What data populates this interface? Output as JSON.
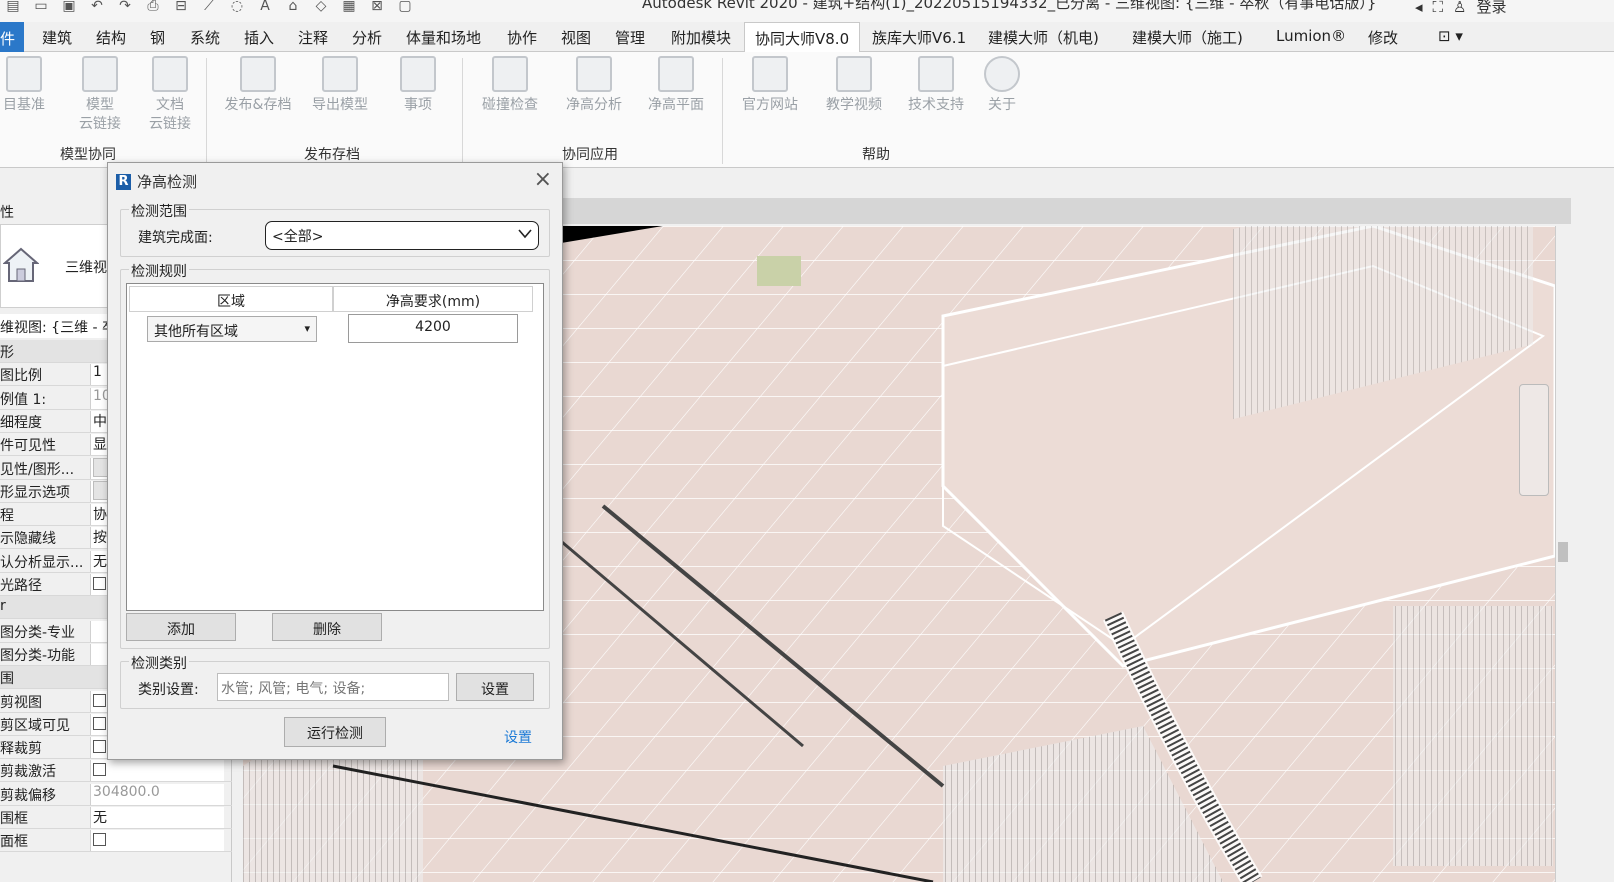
{
  "app": {
    "title": "Autodesk Revit 2020 - 建筑+结构(1)_20220515194332_已分离 - 三维视图: {三维 - 卒秋（有事电话版）}",
    "login": "登录"
  },
  "tabs": [
    "件",
    "建筑",
    "结构",
    "钢",
    "系统",
    "插入",
    "注释",
    "分析",
    "体量和场地",
    "协作",
    "视图",
    "管理",
    "附加模块",
    "协同大师V8.0",
    "族库大师V6.1",
    "建模大师（机电)",
    "建模大师（施工)",
    "Lumion®",
    "修改"
  ],
  "active_tab": "协同大师V8.0",
  "ribbon": {
    "buttons": [
      {
        "label": "目基准",
        "icon": "project-base-icon"
      },
      {
        "label": "模型\n云链接",
        "icon": "rvt-cloud-link-icon"
      },
      {
        "label": "文档\n云链接",
        "icon": "doc-cloud-link-icon"
      },
      {
        "label": "发布&存档",
        "icon": "publish-archive-icon"
      },
      {
        "label": "导出模型",
        "icon": "export-rvt-icon"
      },
      {
        "label": "事项",
        "icon": "checklist-icon"
      },
      {
        "label": "碰撞检查",
        "icon": "collision-check-icon"
      },
      {
        "label": "净高分析",
        "icon": "clearance-analysis-icon"
      },
      {
        "label": "净高平面",
        "icon": "clearance-plan-icon"
      },
      {
        "label": "官方网站",
        "icon": "website-icon"
      },
      {
        "label": "教学视频",
        "icon": "video-icon"
      },
      {
        "label": "技术支持",
        "icon": "support-icon"
      },
      {
        "label": "关于",
        "icon": "info-icon"
      }
    ],
    "groups": [
      "模型协同",
      "发布存档",
      "协同应用",
      "帮助"
    ]
  },
  "properties": {
    "header": "性",
    "type_name": "三维视",
    "view_selector": "维视图: {三维 - 卒",
    "rows": [
      {
        "k": "形",
        "v": "",
        "kind": "section"
      },
      {
        "k": "图比例",
        "v": "1",
        "kind": "text"
      },
      {
        "k": "例值 1:",
        "v": "10",
        "kind": "grey"
      },
      {
        "k": "细程度",
        "v": "中",
        "kind": "text"
      },
      {
        "k": "件可见性",
        "v": "显",
        "kind": "text"
      },
      {
        "k": "见性/图形...",
        "v": "",
        "kind": "button"
      },
      {
        "k": "形显示选项",
        "v": "",
        "kind": "button"
      },
      {
        "k": "程",
        "v": "协",
        "kind": "text"
      },
      {
        "k": "示隐藏线",
        "v": "按",
        "kind": "text"
      },
      {
        "k": "认分析显示...",
        "v": "无",
        "kind": "text"
      },
      {
        "k": "光路径",
        "v": "",
        "kind": "check"
      },
      {
        "k": "r",
        "v": "",
        "kind": "section"
      },
      {
        "k": "图分类-专业",
        "v": "",
        "kind": "text"
      },
      {
        "k": "图分类-功能",
        "v": "",
        "kind": "text"
      },
      {
        "k": "围",
        "v": "",
        "kind": "section"
      },
      {
        "k": "剪视图",
        "v": "",
        "kind": "check"
      },
      {
        "k": "剪区域可见",
        "v": "",
        "kind": "check"
      },
      {
        "k": "释裁剪",
        "v": "",
        "kind": "check"
      },
      {
        "k": "剪裁激活",
        "v": "",
        "kind": "check"
      },
      {
        "k": "剪裁偏移",
        "v": "304800.0",
        "kind": "grey"
      },
      {
        "k": "围框",
        "v": "无",
        "kind": "text"
      },
      {
        "k": "面框",
        "v": "",
        "kind": "check"
      }
    ]
  },
  "dialog": {
    "title": "净高检测",
    "scope": {
      "legend": "检测范围",
      "label": "建筑完成面:",
      "value": "<全部>"
    },
    "rules": {
      "legend": "检测规则",
      "col_area": "区域",
      "col_height": "净高要求(mm)",
      "row_area": "其他所有区域",
      "row_height": "4200",
      "add": "添加",
      "delete": "删除"
    },
    "category": {
      "legend": "检测类别",
      "label": "类别设置:",
      "value": "水管; 风管; 电气; 设备;",
      "settings": "设置"
    },
    "run": "运行检测",
    "settings_link": "设置"
  }
}
